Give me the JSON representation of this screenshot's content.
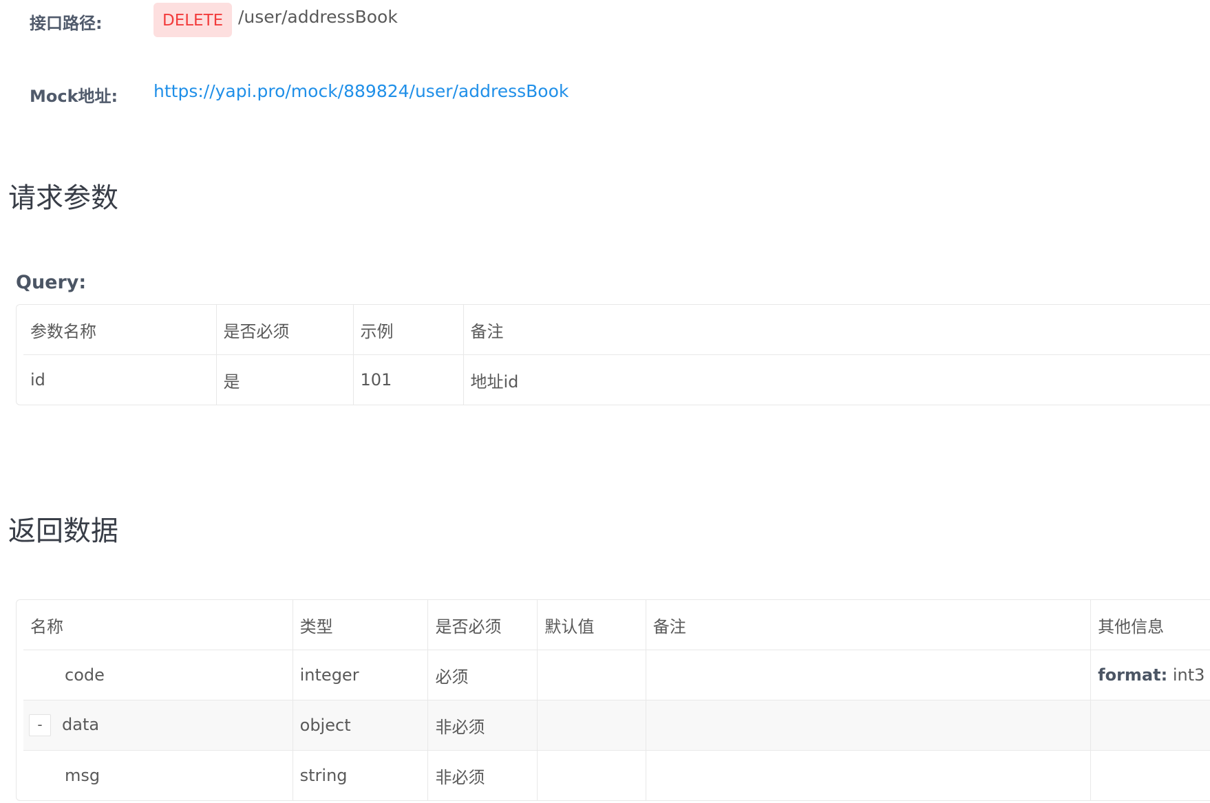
{
  "api": {
    "path_label": "接口路径:",
    "method": "DELETE",
    "path": "/user/addressBook",
    "mock_label": "Mock地址:",
    "mock_url": "https://yapi.pro/mock/889824/user/addressBook"
  },
  "request": {
    "section_title": "请求参数",
    "query_label": "Query:",
    "columns": [
      "参数名称",
      "是否必须",
      "示例",
      "备注"
    ],
    "rows": [
      {
        "name": "id",
        "required": "是",
        "example": "101",
        "note": "地址id"
      }
    ]
  },
  "response": {
    "section_title": "返回数据",
    "columns": [
      "名称",
      "类型",
      "是否必须",
      "默认值",
      "备注",
      "其他信息"
    ],
    "rows": [
      {
        "name": "code",
        "type": "integer",
        "required": "必须",
        "default": "",
        "note": "",
        "other_key": "format:",
        "other_value": "int3"
      },
      {
        "expand": "-",
        "name": "data",
        "type": "object",
        "required": "非必须",
        "default": "",
        "note": "",
        "other_key": "",
        "other_value": ""
      },
      {
        "name": "msg",
        "type": "string",
        "required": "非必须",
        "default": "",
        "note": "",
        "other_key": "",
        "other_value": ""
      }
    ]
  },
  "colors": {
    "method_bg": "#fddfdf",
    "method_text": "#f23b3b",
    "link": "#1f8fe8"
  }
}
